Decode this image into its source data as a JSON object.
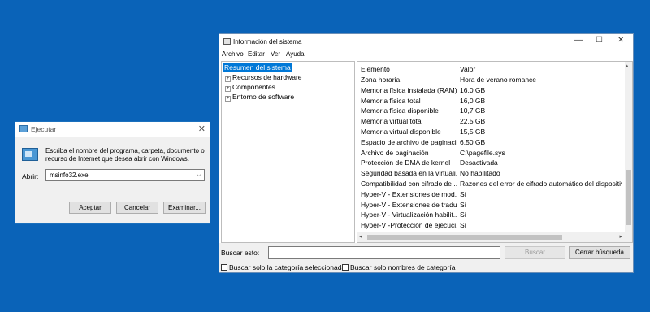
{
  "run_dialog": {
    "title": "Ejecutar",
    "description": "Escriba el nombre del programa, carpeta, documento o recurso de Internet que desea abrir con Windows.",
    "open_label": "Abrir:",
    "input_value": "msinfo32.exe",
    "buttons": {
      "ok": "Aceptar",
      "cancel": "Cancelar",
      "browse": "Examinar..."
    }
  },
  "sysinfo": {
    "title": "Información del sistema",
    "menu": [
      "Archivo",
      "Editar",
      "Ver",
      "Ayuda"
    ],
    "tree": [
      {
        "label": "Resumen del sistema",
        "selected": true,
        "expandable": false
      },
      {
        "label": "Recursos de hardware",
        "selected": false,
        "expandable": true
      },
      {
        "label": "Componentes",
        "selected": false,
        "expandable": true
      },
      {
        "label": "Entorno de software",
        "selected": false,
        "expandable": true
      }
    ],
    "columns": {
      "item": "Elemento",
      "value": "Valor"
    },
    "rows": [
      {
        "item": "Zona horaria",
        "value": "Hora de verano romance"
      },
      {
        "item": "Memoria física instalada (RAM)",
        "value": "16,0 GB"
      },
      {
        "item": "Memoria física total",
        "value": "16,0 GB"
      },
      {
        "item": "Memoria física disponible",
        "value": "10,7 GB"
      },
      {
        "item": "Memoria virtual total",
        "value": "22,5 GB"
      },
      {
        "item": "Memoria virtual disponible",
        "value": "15,5 GB"
      },
      {
        "item": "Espacio de archivo de paginaci...",
        "value": "6,50 GB"
      },
      {
        "item": "Archivo de paginación",
        "value": "C:\\pagefile.sys"
      },
      {
        "item": "Protección de DMA de kernel",
        "value": "Desactivada"
      },
      {
        "item": "Seguridad basada en la virtuali...",
        "value": "No habilitado"
      },
      {
        "item": "Compatibilidad con cifrado de ...",
        "value": "Razones del error de cifrado automático del dispositivo"
      },
      {
        "item": "Hyper-V - Extensiones de mod...",
        "value": "Sí"
      },
      {
        "item": "Hyper-V - Extensiones de tradu...",
        "value": "Sí"
      },
      {
        "item": "Hyper-V - Virtualización habilit...",
        "value": "Sí"
      },
      {
        "item": "Hyper-V -Protección de ejecuci...",
        "value": "Sí"
      }
    ],
    "find": {
      "label": "Buscar esto:",
      "input_value": "",
      "search_button": "Buscar",
      "close_button": "Cerrar búsqueda",
      "check_selected": "Buscar solo la categoría seleccionada",
      "check_names": "Buscar solo nombres de categoría"
    }
  },
  "colors": {
    "desktop": "#0a63b8",
    "selection": "#0078d7"
  }
}
